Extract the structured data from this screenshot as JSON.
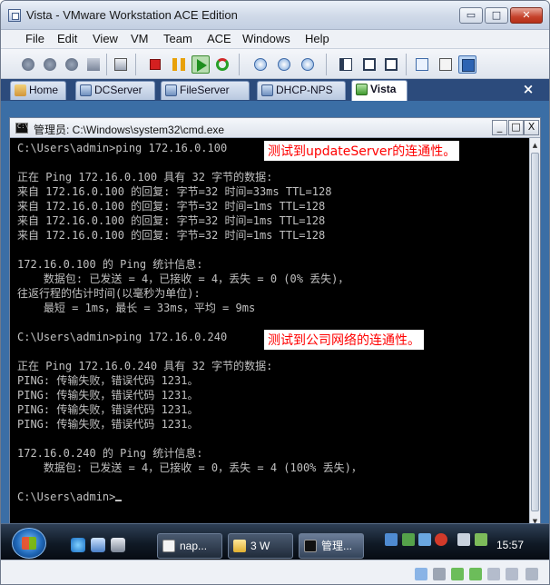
{
  "window": {
    "title": "Vista - VMware Workstation ACE Edition",
    "min_glyph": "▭",
    "max_glyph": "□",
    "close_glyph": "✕"
  },
  "menu": [
    "File",
    "Edit",
    "View",
    "VM",
    "Team",
    "ACE",
    "Windows",
    "Help"
  ],
  "tabs": [
    {
      "label": "Home",
      "icon": "home-icon",
      "active": false
    },
    {
      "label": "DCServer",
      "icon": "vm-icon",
      "active": false
    },
    {
      "label": "FileServer",
      "icon": "vm-icon",
      "active": false
    },
    {
      "label": "DHCP-NPS",
      "icon": "vm-icon",
      "active": false
    },
    {
      "label": "Vista",
      "icon": "vm-running-icon",
      "active": true
    }
  ],
  "tab_close_glyph": "×",
  "cmd": {
    "title": "管理员: C:\\Windows\\system32\\cmd.exe",
    "min_glyph": "_",
    "max_glyph": "□",
    "close_glyph": "X",
    "lines": [
      "C:\\Users\\admin>ping 172.16.0.100",
      "",
      "正在 Ping 172.16.0.100 具有 32 字节的数据:",
      "来自 172.16.0.100 的回复: 字节=32 时间=33ms TTL=128",
      "来自 172.16.0.100 的回复: 字节=32 时间=1ms TTL=128",
      "来自 172.16.0.100 的回复: 字节=32 时间=1ms TTL=128",
      "来自 172.16.0.100 的回复: 字节=32 时间=1ms TTL=128",
      "",
      "172.16.0.100 的 Ping 统计信息:",
      "    数据包: 已发送 = 4，已接收 = 4，丢失 = 0 (0% 丢失)，",
      "往返行程的估计时间(以毫秒为单位):",
      "    最短 = 1ms，最长 = 33ms，平均 = 9ms",
      "",
      "C:\\Users\\admin>ping 172.16.0.240",
      "",
      "正在 Ping 172.16.0.240 具有 32 字节的数据:",
      "PING: 传输失败，错误代码 1231。",
      "PING: 传输失败，错误代码 1231。",
      "PING: 传输失败，错误代码 1231。",
      "PING: 传输失败，错误代码 1231。",
      "",
      "172.16.0.240 的 Ping 统计信息:",
      "    数据包: 已发送 = 4，已接收 = 0，丢失 = 4 (100% 丢失)，",
      "",
      "C:\\Users\\admin>"
    ],
    "annotations": [
      "测试到updateServer的连通性。",
      "测试到公司网络的连通性。"
    ]
  },
  "taskbar": {
    "tasks": [
      {
        "label": "nap...",
        "icon": "doc-icon"
      },
      {
        "label": "3 W",
        "icon": "folder-icon"
      },
      {
        "label": "管理...",
        "icon": "cmd-icon"
      }
    ],
    "clock": "15:57"
  },
  "colors": {
    "annotation": "#ff0000",
    "console_text": "#c0c0c0",
    "console_bg": "#000000",
    "tab_bar": "#2c4b7c",
    "desktop": "#3b6ea5"
  }
}
